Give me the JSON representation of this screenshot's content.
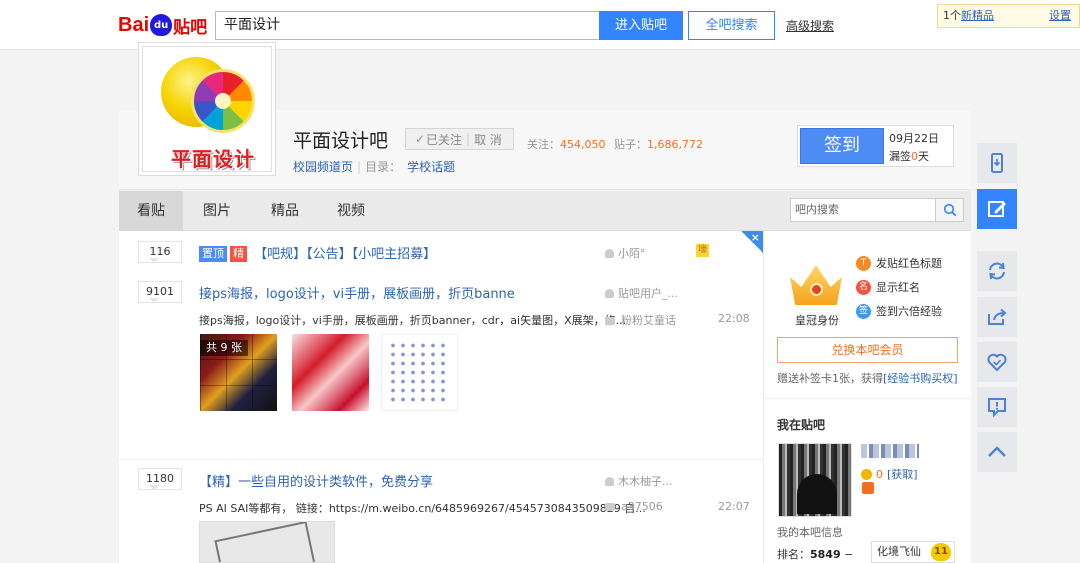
{
  "topbar": {
    "logo_bai": "Bai",
    "logo_du": "du",
    "logo_tieba": "贴吧",
    "search_value": "平面设计",
    "enter_button": "进入贴吧",
    "all_search_button": "全吧搜索",
    "advanced_search": "高级搜索",
    "notice_prefix": "1个",
    "notice_link": "新精品",
    "notice_settings": "设置"
  },
  "forum": {
    "avatar_text": "平面设计",
    "name": "平面设计吧",
    "follow_label": "已关注",
    "unfollow_label": "取 消",
    "followers_label": "关注：",
    "followers_value": "454,050",
    "posts_label": "贴子：",
    "posts_value": "1,686,772",
    "channel_link": "校园频道页",
    "catalog_label": "目录：",
    "catalog_link": "学校话题",
    "sign_button": "签到",
    "sign_date": "09月22日",
    "missed_prefix": "漏签",
    "missed_count": "0",
    "missed_suffix": "天"
  },
  "tabs": [
    {
      "label": "看贴"
    },
    {
      "label": "图片"
    },
    {
      "label": "精品"
    },
    {
      "label": "视频"
    }
  ],
  "inner_search_placeholder": "吧内搜索",
  "threads": [
    {
      "reply_count": "116",
      "tag_top": "置顶",
      "tag_good": "精",
      "title": "【吧规】【公告】【小吧主招募】",
      "author": "小陌°",
      "badge": "壕"
    },
    {
      "reply_count": "9101",
      "title": "接ps海报，logo设计，vi手册，展板画册，折页banne",
      "author": "贴吧用户_...",
      "abstract": "接ps海报，logo设计，vi手册，展板画册，折页banner，cdr，ai矢量图，X展架，修...",
      "last_reply": "粉粉艾童话",
      "time": "22:08",
      "image_count": "共 9 张"
    },
    {
      "reply_count": "1180",
      "title": "【精】一些自用的设计类软件，免费分享",
      "author": "木木柚子...",
      "abstract": "PS AI SAI等都有， 链接：https://m.weibo.cn/6485969267/4545730843509829 自...",
      "last_reply": "a37506",
      "time": "22:07"
    }
  ],
  "right_panel": {
    "crown_label": "皇冠身份",
    "perks": [
      "发贴红色标题",
      "显示红名",
      "签到六倍经验"
    ],
    "redeem_button": "兑换本吧会员",
    "gift_text": "赠送补签卡1张，获得",
    "gift_link": "[经验书购买权]",
    "my_title": "我在贴吧",
    "coin_count": "0",
    "coin_link": "[获取]",
    "my_info": "我的本吧信息",
    "rank_label": "排名：",
    "rank_value": "5849",
    "rank_trend": "−",
    "level_title": "化境飞仙",
    "level_number": "11"
  },
  "floating_toolbar": [
    "mobile-icon",
    "edit-icon",
    "refresh-icon",
    "share-icon",
    "favorite-icon",
    "report-icon",
    "back-to-top-icon"
  ],
  "colors": {
    "accent_blue": "#3385ff",
    "link_blue": "#2d64b3",
    "orange": "#f56e1e",
    "brand_red": "#e10601"
  }
}
